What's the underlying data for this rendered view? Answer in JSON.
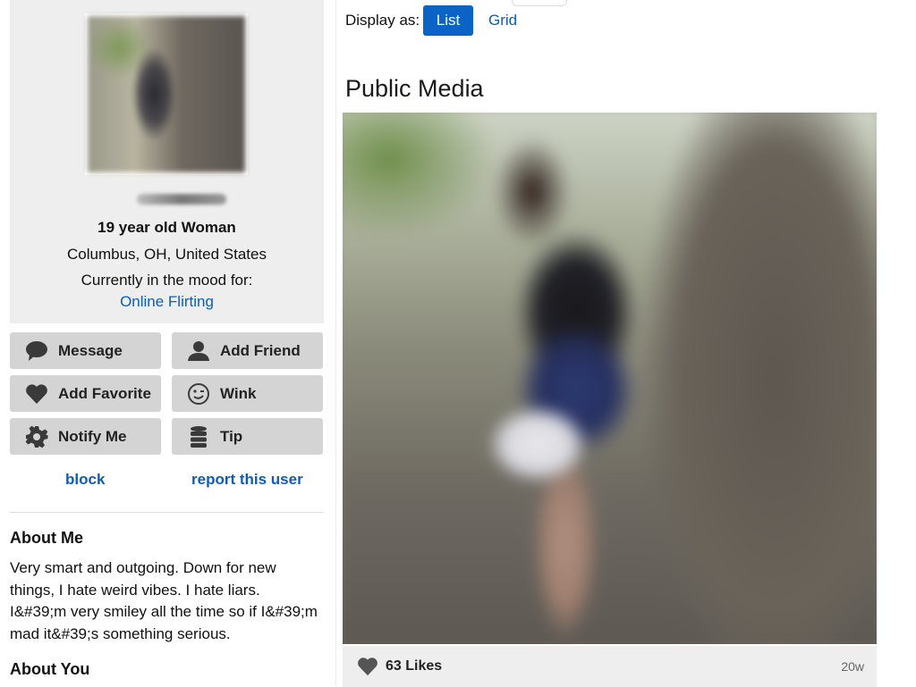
{
  "profile": {
    "age_gender": "19 year old Woman",
    "location": "Columbus, OH, United States",
    "mood_label": "Currently in the mood for:",
    "mood_value": "Online Flirting"
  },
  "actions": [
    {
      "label": "Message",
      "icon": "speech-bubble-icon"
    },
    {
      "label": "Add Friend",
      "icon": "person-icon"
    },
    {
      "label": "Add Favorite",
      "icon": "heart-icon"
    },
    {
      "label": "Wink",
      "icon": "wink-face-icon"
    },
    {
      "label": "Notify Me",
      "icon": "gear-icon"
    },
    {
      "label": "Tip",
      "icon": "coin-stack-icon"
    }
  ],
  "links": {
    "block": "block",
    "report": "report this user"
  },
  "about": {
    "me_heading": "About Me",
    "me_text": "Very smart and outgoing. Down for new things, I hate weird vibes. I hate liars. I&#39;m very smiley all the time so if I&#39;m mad it&#39;s something serious.",
    "you_heading": "About You"
  },
  "display": {
    "label": "Display as:",
    "list": "List",
    "grid": "Grid",
    "selected": "List"
  },
  "media": {
    "title": "Public Media",
    "likes": "63 Likes",
    "age": "20w"
  },
  "colors": {
    "accent": "#0b63c5",
    "link": "#0b5db8",
    "panel": "#eeeeee",
    "button": "#d4d4d4"
  }
}
